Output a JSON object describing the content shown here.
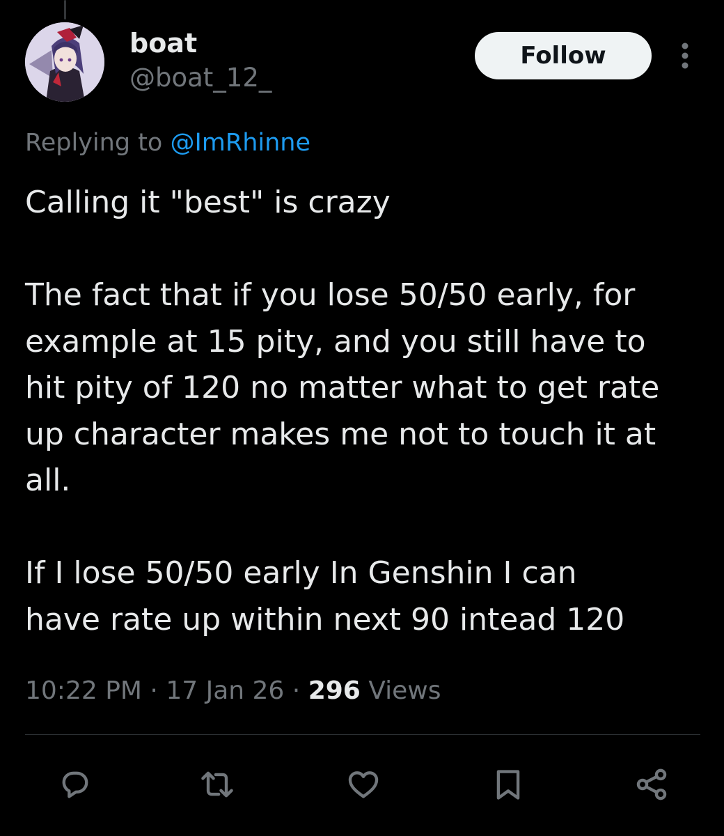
{
  "tweet": {
    "author": {
      "display_name": "boat",
      "handle": "@boat_12_"
    },
    "follow_label": "Follow",
    "replying_prefix": "Replying to ",
    "replying_to": "@ImRhinne",
    "paragraphs": [
      "Calling it \"best\" is crazy",
      "The fact that if you lose 50/50 early, for\nexample at 15 pity, and you still have to\nhit pity of 120 no matter what to get rate\nup character makes me not to touch it at\nall.",
      "If I lose 50/50 early In Genshin I can\nhave rate up within next 90 intead 120"
    ],
    "time": "10:22 PM",
    "separator": "·",
    "date": "17 Jan 26",
    "views_count": "296",
    "views_label": "Views"
  },
  "actions": [
    {
      "name": "reply",
      "icon": "reply-icon"
    },
    {
      "name": "repost",
      "icon": "repost-icon"
    },
    {
      "name": "like",
      "icon": "heart-icon"
    },
    {
      "name": "bookmark",
      "icon": "bookmark-icon"
    },
    {
      "name": "share",
      "icon": "share-icon"
    }
  ],
  "colors": {
    "background": "#000000",
    "text_primary": "#e7e9ea",
    "text_secondary": "#71767b",
    "link": "#1d9bf0",
    "follow_bg": "#eff3f4",
    "divider": "#2f3336"
  }
}
